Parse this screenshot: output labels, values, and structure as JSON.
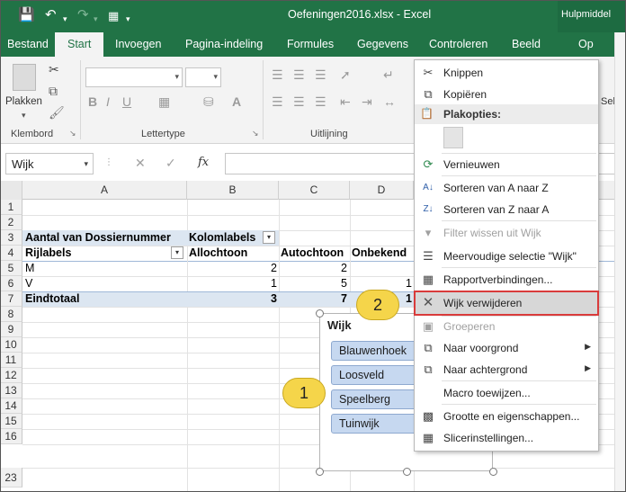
{
  "window": {
    "title": "Oefeningen2016.xlsx - Excel",
    "context_tab_label": "Hulpmiddel"
  },
  "ribbon": {
    "tabs": [
      {
        "label": "Bestand"
      },
      {
        "label": "Start"
      },
      {
        "label": "Invoegen"
      },
      {
        "label": "Pagina-indeling"
      },
      {
        "label": "Formules"
      },
      {
        "label": "Gegevens"
      },
      {
        "label": "Controleren"
      },
      {
        "label": "Beeld"
      },
      {
        "label": "Op"
      }
    ],
    "paste_label": "Plakken",
    "groups": {
      "clipboard": "Klembord",
      "font": "Lettertype",
      "alignment": "Uitlijning"
    },
    "right_label_fragment": "Selelk"
  },
  "formula_bar": {
    "name_box": "Wijk",
    "fx": "fx"
  },
  "sheet": {
    "columns": [
      "A",
      "B",
      "C",
      "D"
    ],
    "rows": [
      "1",
      "2",
      "3",
      "4",
      "5",
      "6",
      "7",
      "8",
      "9",
      "10",
      "11",
      "12",
      "13",
      "14",
      "15",
      "16",
      "23"
    ],
    "cells": {
      "a3": "Aantal van Dossiernummer",
      "b3": "Kolomlabels",
      "a4": "Rijlabels",
      "b4": "Allochtoon",
      "c4": "Autochtoon",
      "d4": "Onbekend",
      "a5": "M",
      "b5": "2",
      "c5": "2",
      "a6": "V",
      "b6": "1",
      "c6": "5",
      "d6": "1",
      "a7": "Eindtotaal",
      "b7": "3",
      "c7": "7",
      "d7": "1"
    }
  },
  "slicer": {
    "title": "Wijk",
    "items": [
      "Blauwenhoek",
      "Loosveld",
      "Speelberg",
      "Tuinwijk"
    ]
  },
  "callouts": {
    "one": "1",
    "two": "2"
  },
  "context_menu": {
    "paste_options_header": "Plakopties:",
    "items": [
      {
        "label": "Knippen",
        "icon": "scissors-icon"
      },
      {
        "label": "Kopiëren",
        "icon": "copy-icon"
      },
      {
        "label": "Vernieuwen",
        "icon": "refresh-icon"
      },
      {
        "label": "Sorteren van A naar Z",
        "icon": "sort-az-icon"
      },
      {
        "label": "Sorteren van Z naar A",
        "icon": "sort-za-icon"
      },
      {
        "label": "Filter wissen uit Wijk",
        "icon": "clear-filter-icon",
        "disabled": true
      },
      {
        "label": "Meervoudige selectie \"Wijk\"",
        "icon": "multiselect-icon"
      },
      {
        "label": "Rapportverbindingen...",
        "icon": "report-connections-icon"
      },
      {
        "label": "Wijk verwijderen",
        "icon": "remove-icon",
        "highlighted": true
      },
      {
        "label": "Groeperen",
        "icon": "group-icon",
        "disabled": true
      },
      {
        "label": "Naar voorgrond",
        "icon": "bring-forward-icon",
        "submenu": true
      },
      {
        "label": "Naar achtergrond",
        "icon": "send-backward-icon",
        "submenu": true
      },
      {
        "label": "Macro toewijzen...",
        "icon": ""
      },
      {
        "label": "Grootte en eigenschappen...",
        "icon": "size-properties-icon"
      },
      {
        "label": "Slicerinstellingen...",
        "icon": "slicer-settings-icon"
      }
    ]
  },
  "colors": {
    "excel_green": "#217346",
    "slicer_item": "#c6d8f0",
    "callout_yellow": "#f5d54a",
    "highlight_border": "#d93b3b"
  }
}
